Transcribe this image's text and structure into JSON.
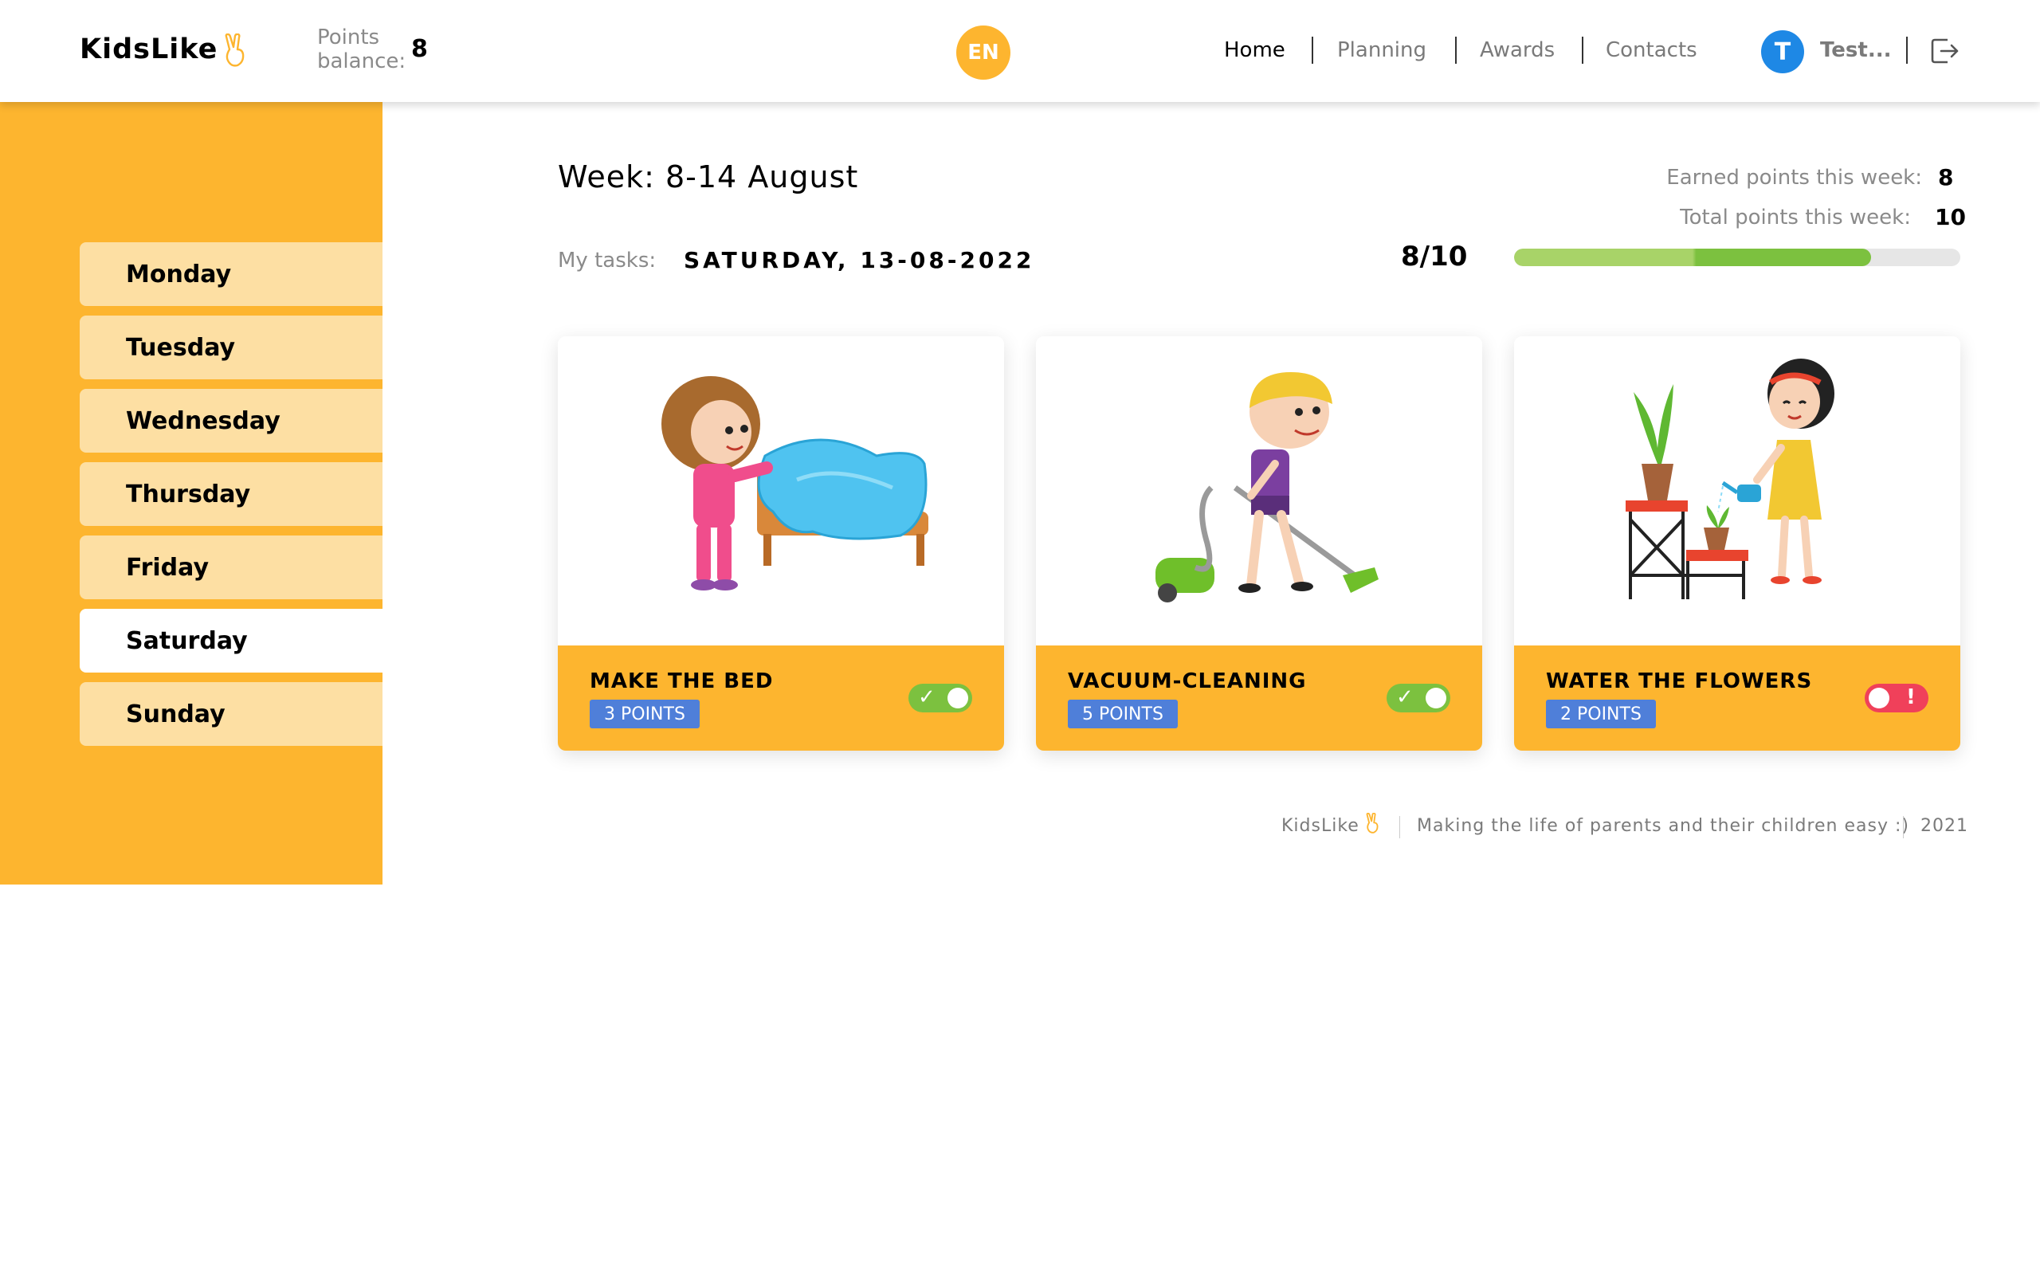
{
  "header": {
    "app_name": "KidsLike",
    "balance_label": "Points balance:",
    "balance_value": "8",
    "language": "EN",
    "nav": [
      {
        "label": "Home",
        "active": true
      },
      {
        "label": "Planning",
        "active": false
      },
      {
        "label": "Awards",
        "active": false
      },
      {
        "label": "Contacts",
        "active": false
      }
    ],
    "user_initial": "T",
    "user_name": "Test...",
    "logout_icon": "logout-icon",
    "logo_icon": "peace-hand-icon"
  },
  "sidebar": {
    "days": [
      {
        "label": "Monday",
        "active": false
      },
      {
        "label": "Tuesday",
        "active": false
      },
      {
        "label": "Wednesday",
        "active": false
      },
      {
        "label": "Thursday",
        "active": false
      },
      {
        "label": "Friday",
        "active": false
      },
      {
        "label": "Saturday",
        "active": true
      },
      {
        "label": "Sunday",
        "active": false
      }
    ]
  },
  "main": {
    "week_title": "Week: 8-14 August",
    "tasks_label": "My tasks:",
    "tasks_date": "SATURDAY, 13-08-2022",
    "earned_label": "Earned points this week:",
    "earned_value": "8",
    "total_label": "Total points this week:",
    "total_value": "10",
    "ratio": "8/10",
    "progress": 0.8
  },
  "cards": [
    {
      "title": "MAKE THE BED",
      "points": "3 POINTS",
      "done": true,
      "image": "girl-making-bed-illustration"
    },
    {
      "title": "VACUUM-CLEANING",
      "points": "5 POINTS",
      "done": true,
      "image": "boy-vacuuming-illustration"
    },
    {
      "title": "WATER THE FLOWERS",
      "points": "2 POINTS",
      "done": false,
      "image": "girl-watering-plants-illustration"
    }
  ],
  "footer": {
    "brand": "KidsLike",
    "slogan": "Making the life of parents and their children easy :)",
    "year": "2021"
  },
  "colors": {
    "accent": "#fdb52f",
    "sidebar_item": "#fddfa3",
    "points_badge": "#4f7fd9",
    "toggle_on": "#7cc13f",
    "toggle_off": "#f0405a"
  }
}
